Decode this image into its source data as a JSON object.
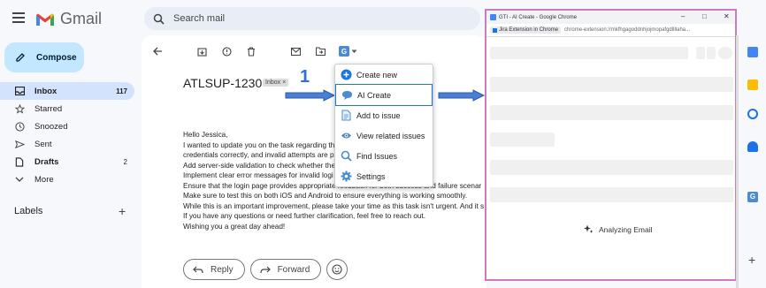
{
  "app": {
    "name": "Gmail"
  },
  "compose": {
    "label": "Compose"
  },
  "search": {
    "placeholder": "Search mail"
  },
  "nav": [
    {
      "label": "Inbox",
      "count": "117",
      "icon": "inbox-icon"
    },
    {
      "label": "Starred",
      "count": "",
      "icon": "star-icon"
    },
    {
      "label": "Snoozed",
      "count": "",
      "icon": "clock-icon"
    },
    {
      "label": "Sent",
      "count": "",
      "icon": "send-icon"
    },
    {
      "label": "Drafts",
      "count": "2",
      "icon": "draft-icon"
    },
    {
      "label": "More",
      "count": "",
      "icon": "chevron-down-icon"
    }
  ],
  "labels": {
    "title": "Labels"
  },
  "message": {
    "subject": "ATLSUP-1230",
    "badge": "Inbox ×",
    "lines": [
      "Hello Jessica,",
      "I wanted to update you on the task regarding th                    bile app, for the",
      "credentials correctly, and invalid attempts are p                    error handling. W",
      "Add server-side validation to check whether the                     correct.",
      "Implement clear error messages for invalid logi",
      "Ensure that the login page provides appropriate feedback for both success and failure scenar",
      "Make sure to test this on both iOS and Android to ensure everything is working smoothly.",
      "While this is an important improvement, please take your time as this task isn't urgent. And it s",
      "If you have any questions or need further clarification, feel free to reach out.",
      "Wishing you a great day ahead!"
    ]
  },
  "step_number": "1",
  "reply": {
    "reply_label": "Reply",
    "forward_label": "Forward"
  },
  "dropdown": {
    "items": [
      {
        "label": "Create new",
        "icon": "plus-circle-icon"
      },
      {
        "label": "AI Create",
        "icon": "chat-bubble-icon"
      },
      {
        "label": "Add to issue",
        "icon": "document-icon"
      },
      {
        "label": "View related issues",
        "icon": "eye-icon"
      },
      {
        "label": "Find Issues",
        "icon": "search-icon"
      },
      {
        "label": "Settings",
        "icon": "gear-icon"
      }
    ]
  },
  "popup": {
    "title": "GTI - AI Create - Google Chrome",
    "chip": "Jira Extension in Chrome",
    "url": "chrome-extension://mkfhgagoddnhjojmopafgdllllaha...",
    "status": "Analyzing Email"
  },
  "colors": {
    "accent": "#2f6fd6",
    "popup_border": "#c77dbf",
    "compose_bg": "#c2e7ff"
  }
}
